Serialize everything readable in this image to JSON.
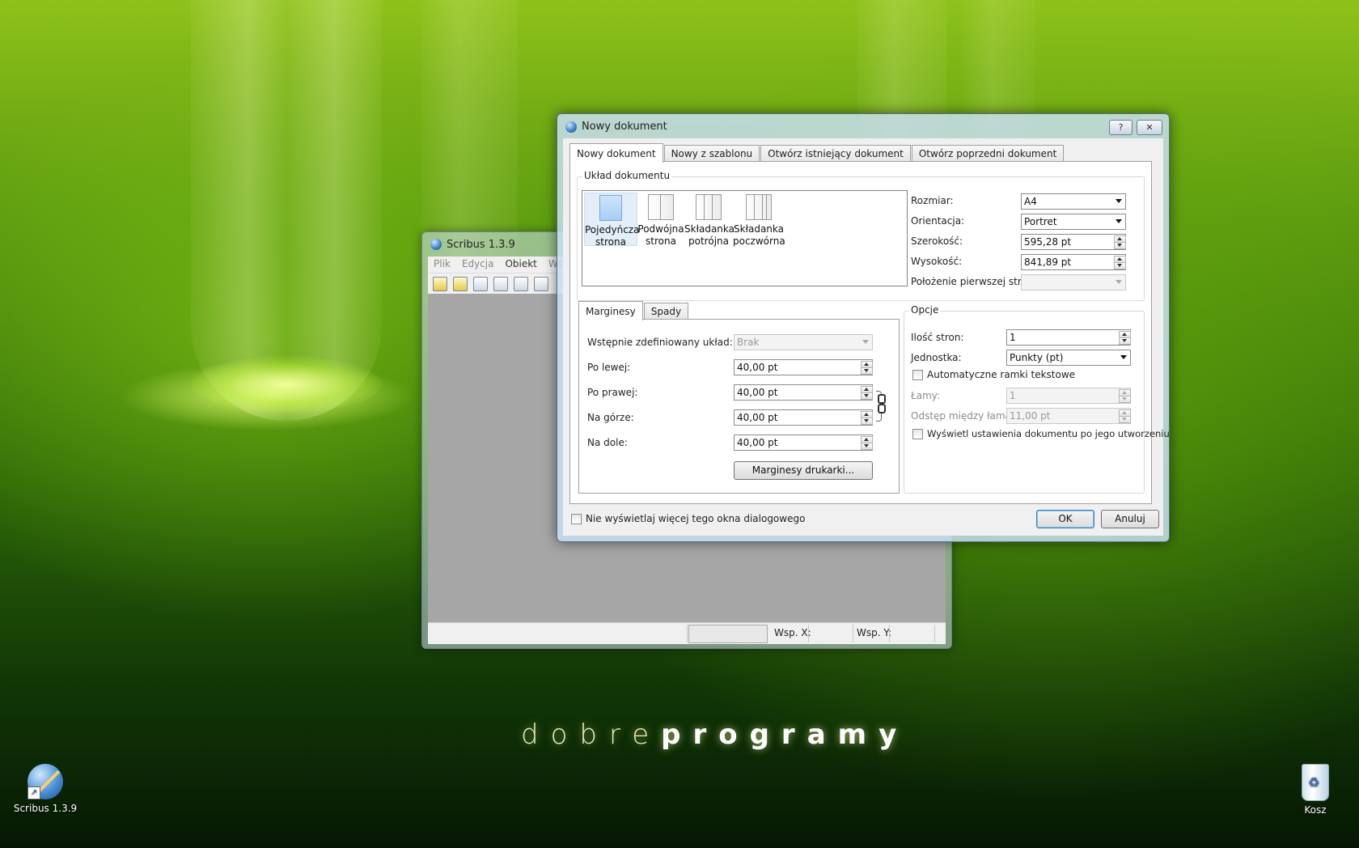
{
  "desktop": {
    "brand_light": "dobre",
    "brand_bold": "programy",
    "icons": [
      {
        "label": "Scribus 1.3.9",
        "icon": "scribus-icon"
      },
      {
        "label": "Kosz",
        "icon": "recycle-bin-icon"
      }
    ]
  },
  "main_window": {
    "title": "Scribus 1.3.9",
    "menu": [
      "Plik",
      "Edycja",
      "Obiekt",
      "Ws"
    ],
    "status": {
      "x_label": "Wsp. X:",
      "y_label": "Wsp. Y:"
    }
  },
  "dialog": {
    "title": "Nowy dokument",
    "help_button": "?",
    "close_button": "✕",
    "tabs": [
      "Nowy dokument",
      "Nowy z szablonu",
      "Otwórz istniejący dokument",
      "Otwórz poprzedni dokument"
    ],
    "layout_group": {
      "title": "Układ dokumentu",
      "items": [
        {
          "line1": "Pojedyńcza",
          "line2": "strona"
        },
        {
          "line1": "Podwójna",
          "line2": "strona"
        },
        {
          "line1": "Składanka",
          "line2": "potrójna"
        },
        {
          "line1": "Składanka",
          "line2": "poczwórna"
        }
      ],
      "size_label": "Rozmiar:",
      "size_value": "A4",
      "orientation_label": "Orientacja:",
      "orientation_value": "Portret",
      "width_label": "Szerokość:",
      "width_value": "595,28 pt",
      "height_label": "Wysokość:",
      "height_value": "841,89 pt",
      "first_page_label": "Położenie pierwszej strony:",
      "first_page_value": ""
    },
    "margins": {
      "tabs": [
        "Marginesy",
        "Spady"
      ],
      "preset_label": "Wstępnie zdefiniowany układ:",
      "preset_value": "Brak",
      "left_label": "Po lewej:",
      "left_value": "40,00 pt",
      "right_label": "Po prawej:",
      "right_value": "40,00 pt",
      "top_label": "Na górze:",
      "top_value": "40,00 pt",
      "bottom_label": "Na dole:",
      "bottom_value": "40,00 pt",
      "printer_button": "Marginesy drukarki..."
    },
    "options": {
      "title": "Opcje",
      "pages_label": "Ilość stron:",
      "pages_value": "1",
      "unit_label": "Jednostka:",
      "unit_value": "Punkty (pt)",
      "auto_frames_label": "Automatyczne ramki tekstowe",
      "columns_label": "Łamy:",
      "columns_value": "1",
      "gap_label": "Odstęp między łamami:",
      "gap_value": "11,00 pt",
      "show_settings_label": "Wyświetl ustawienia dokumentu po jego utworzeniu"
    },
    "dont_show_label": "Nie wyświetlaj więcej tego okna dialogowego",
    "ok_label": "OK",
    "cancel_label": "Anuluj"
  }
}
